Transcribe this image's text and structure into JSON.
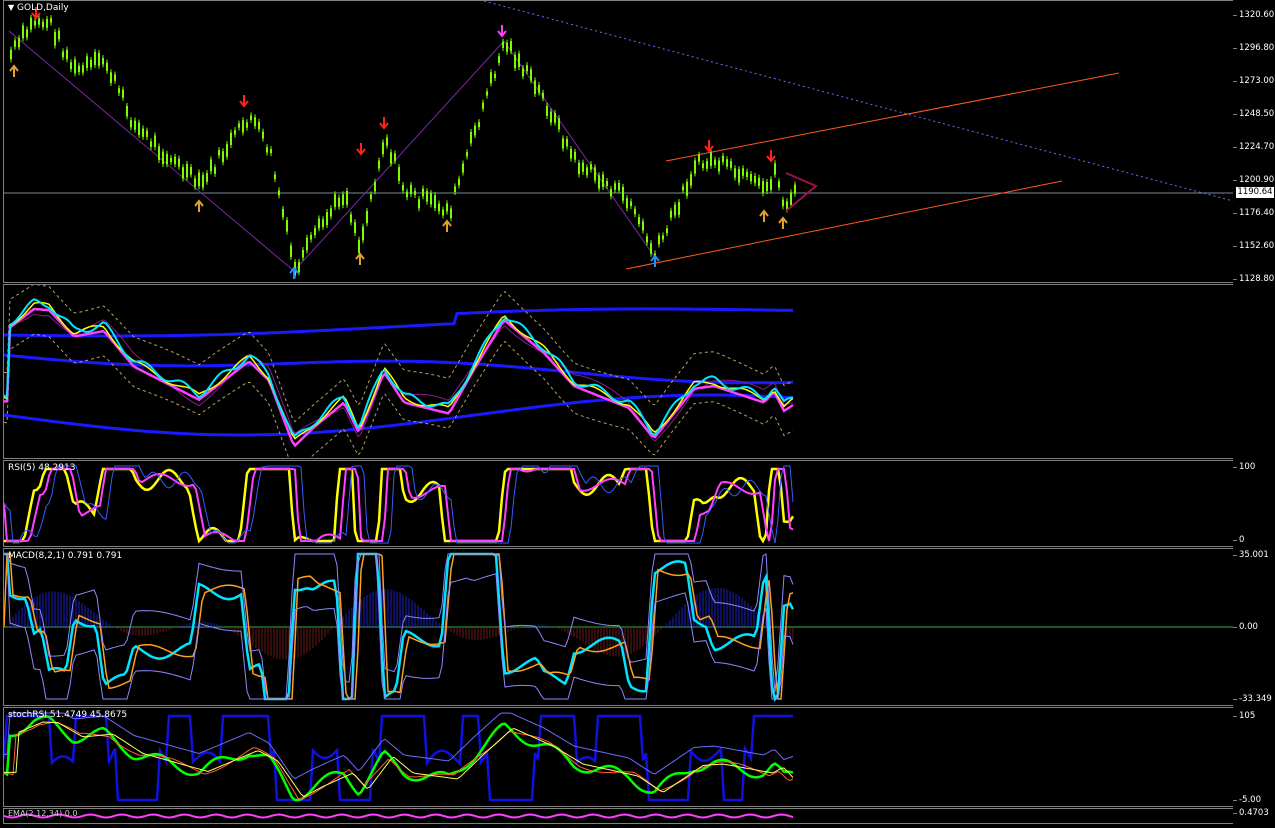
{
  "symbol_label": "GOLD,Daily",
  "current_price": "1190.64",
  "price_axis": [
    "1320.60",
    "1296.80",
    "1273.00",
    "1248.50",
    "1224.70",
    "1200.90",
    "1176.40",
    "1152.60",
    "1128.80"
  ],
  "panels": {
    "bands": {
      "label": ""
    },
    "rsi": {
      "label": "RSI(5) 48.2913",
      "max": "100",
      "min": "0"
    },
    "macd": {
      "label": "MACD(8,2,1) 0.791 0.791",
      "max": "35.001",
      "zero": "0.00",
      "min": "-33.349"
    },
    "stochrsi": {
      "label": "stochRSI 51.4749 45.8675",
      "max": "105",
      "min": "-5.00"
    },
    "bottom": {
      "label": "EMA(2,12,34) 0.0",
      "value": "0.4703"
    }
  },
  "colors": {
    "candle": "#7CFC00",
    "down_arrow": "#ff2020",
    "up_arrow": "#e0a030",
    "blue_arrow": "#1e90ff",
    "magenta_arrow": "#ff40ff",
    "channel": "#ff5a1e",
    "trendline": "#6a6aff"
  }
}
